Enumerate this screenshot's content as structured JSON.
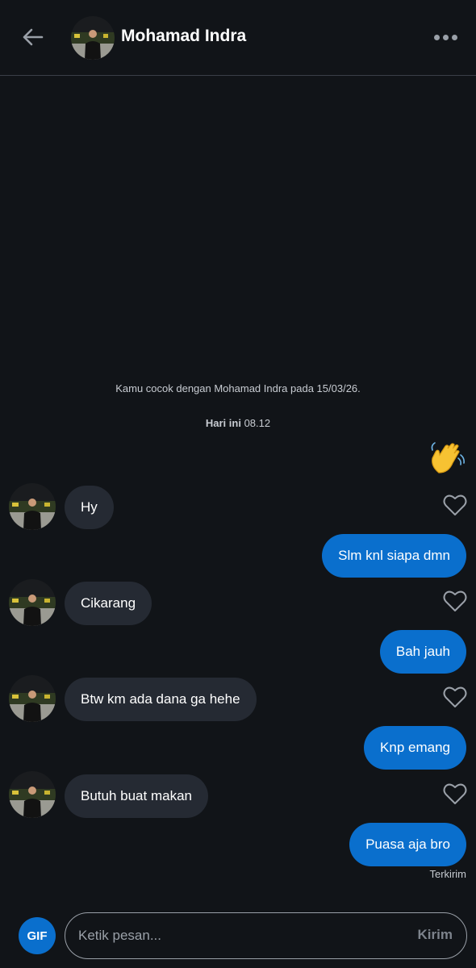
{
  "header": {
    "contact_name": "Mohamad Indra"
  },
  "conversation": {
    "match_info": "Kamu cocok dengan Mohamad Indra pada 15/03/26.",
    "day_label": "Hari ini",
    "day_time": "08.12",
    "wave_emoji": "👋",
    "messages": [
      {
        "side": "in",
        "text": "Hy"
      },
      {
        "side": "out",
        "text": "Slm knl siapa dmn"
      },
      {
        "side": "in",
        "text": "Cikarang"
      },
      {
        "side": "out",
        "text": "Bah jauh"
      },
      {
        "side": "in",
        "text": "Btw km ada dana ga hehe"
      },
      {
        "side": "out",
        "text": "Knp emang"
      },
      {
        "side": "in",
        "text": "Butuh buat makan"
      },
      {
        "side": "out",
        "text": "Puasa aja bro"
      }
    ],
    "status": "Terkirim"
  },
  "composer": {
    "gif_label": "GIF",
    "placeholder": "Ketik pesan...",
    "send_label": "Kirim"
  },
  "colors": {
    "background": "#111418",
    "incoming_bubble": "#252a33",
    "outgoing_bubble": "#0a6fcd"
  }
}
